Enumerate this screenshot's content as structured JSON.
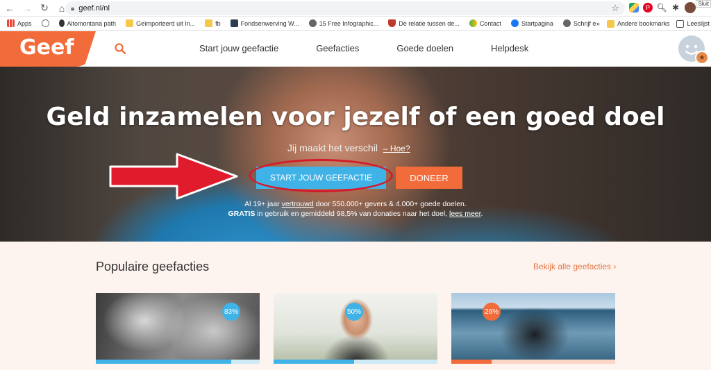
{
  "browser": {
    "url": "geef.nl/nl",
    "corner_label": "Sluit",
    "bookmarks": [
      {
        "label": "Apps"
      },
      {
        "label": "Altomontana path"
      },
      {
        "label": "Geïmporteerd uit In..."
      },
      {
        "label": "fb"
      },
      {
        "label": "Fondsenwerving W..."
      },
      {
        "label": "15 Free Infographic..."
      },
      {
        "label": "De relatie tussen de..."
      },
      {
        "label": "Contact"
      },
      {
        "label": "Startpagina"
      },
      {
        "label": "Schrijf een projectv..."
      }
    ],
    "more_bookmarks": "»",
    "other_bookmarks": "Andere bookmarks",
    "reading_list": "Leeslijst"
  },
  "header": {
    "logo": "Geef",
    "nav": [
      "Start jouw geefactie",
      "Geefacties",
      "Goede doelen",
      "Helpdesk"
    ]
  },
  "hero": {
    "title": "Geld inzamelen voor jezelf of een goed doel",
    "subtitle": "Jij maakt het verschil",
    "subtitle_link": "– Hoe?",
    "start_button": "START JOUW GEEFACTIE",
    "donate_button": "DONEER",
    "info_line1_a": "Al 19+ jaar ",
    "info_line1_u": "vertrouwd",
    "info_line1_b": " door 550.000+ gevers & 4.000+ goede doelen.",
    "info_line2_bold": "GRATIS",
    "info_line2_mid": " in gebruik en gemiddeld 98,5% van donaties naar het doel, ",
    "info_line2_link": "lees meer",
    "info_line2_end": "."
  },
  "popular": {
    "title": "Populaire geefacties",
    "see_all": "Bekijk alle geefacties ›",
    "cards": [
      {
        "progress": 0.83,
        "label": "83%",
        "color": "#3fb3e8"
      },
      {
        "progress": 0.5,
        "label": "50%",
        "color": "#3fb3e8"
      },
      {
        "progress": 0.26,
        "label": "26%",
        "color": "#f26b3a"
      }
    ]
  },
  "colors": {
    "brand_orange": "#f26b3a",
    "brand_blue": "#3fb3e8",
    "annotation_red": "#d51a2a"
  }
}
